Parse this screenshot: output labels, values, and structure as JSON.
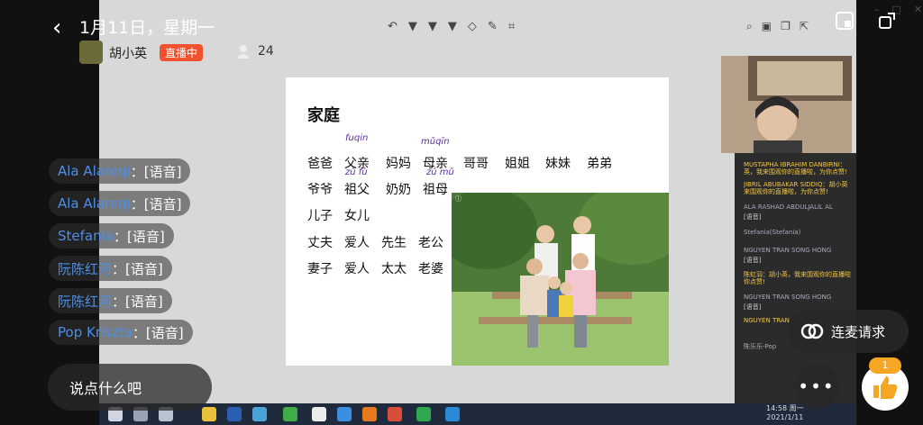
{
  "header": {
    "back_icon": "back-chevron-icon",
    "date_title": "1月11日，星期一",
    "host_name": "胡小英",
    "live_badge": "直播中",
    "viewer_count": "24"
  },
  "slide": {
    "title": "家庭",
    "rows": [
      [
        "爸爸",
        "父亲",
        "妈妈",
        "母亲",
        "哥哥",
        "姐姐",
        "妹妹",
        "弟弟"
      ],
      [
        "爷爷",
        "祖父",
        "奶奶",
        "祖母"
      ],
      [
        "儿子",
        "女儿"
      ],
      [
        "丈夫",
        "爱人",
        "先生",
        "老公"
      ],
      [
        "妻子",
        "爱人",
        "太太",
        "老婆"
      ]
    ],
    "annotations": [
      "fuqin",
      "mǔqīn",
      "zǔ fù",
      "zǔ mǔ"
    ]
  },
  "comments": [
    {
      "name": "Ala Alareqi",
      "text": "：[语音]"
    },
    {
      "name": "Ala Alareqi",
      "text": "：[语音]"
    },
    {
      "name": "Stefania",
      "text": "：[语音]"
    },
    {
      "name": "阮陈红河",
      "text": "：[语音]"
    },
    {
      "name": "阮陈红河",
      "text": "：[语音]"
    },
    {
      "name": "Pop Kriszta",
      "text": "：[语音]"
    }
  ],
  "side_chat": [
    "MUSTAPHA IBRAHIM DANBIRNI：",
    "英，我来围观你的直播啦，为你点赞!",
    "JIBRIL ABUBAKAR SIDDIQ：胡小英",
    "来围观你的直播啦，为你点赞!",
    "ALA RASHAD ABDULJALIL AL",
    "[语音]",
    "Stefania(Stefania)",
    "NGUYEN TRAN SONG HONG",
    "[语音]",
    "陈虹羽：胡小英，我来围观你的直播啦",
    "你点赞!",
    "NGUYEN TRAN SONG HONG",
    "[语音]",
    "NGUYEN TRAN",
    "陈乐乐-Pop"
  ],
  "input_placeholder": "说点什么吧",
  "lianmai_label": "连麦请求",
  "more_label": "•••",
  "like_count": "1",
  "clock": {
    "time": "14:58 周一",
    "date": "2021/1/11"
  },
  "colors": {
    "accent_red": "#f0512f",
    "name_blue": "#4d8fe8",
    "like_badge": "#f5a623"
  }
}
